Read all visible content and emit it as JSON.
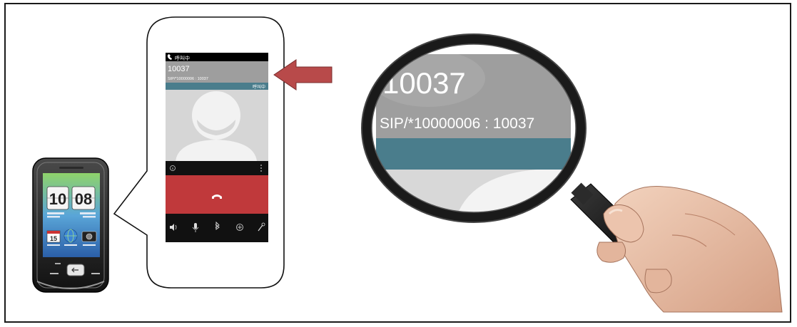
{
  "phone_screen": {
    "status_label": "呼叫中",
    "caller_number": "10037",
    "sip_line": "SIP/*10000006 : 10037",
    "calling_badge": "呼叫中"
  },
  "magnified": {
    "caller_number": "10037",
    "sip_line": "SIP/*10000006 : 10037"
  },
  "device": {
    "clock_hours": "10",
    "clock_minutes": "08",
    "calendar_day": "15"
  },
  "colors": {
    "accent_teal": "#4a7d8c",
    "end_call_red": "#c0393b",
    "arrow_red": "#b84a4a",
    "header_gray": "#9e9e9e"
  }
}
